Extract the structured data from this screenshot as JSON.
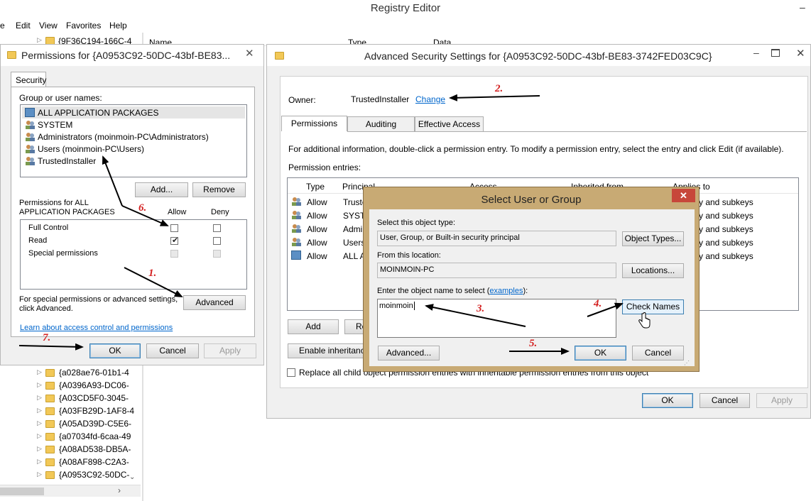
{
  "registry": {
    "title": "Registry Editor",
    "menu": [
      "e",
      "Edit",
      "View",
      "Favorites",
      "Help"
    ],
    "top_node": "{9F36C194-166C-4",
    "columns": [
      "Name",
      "Type",
      "Data"
    ],
    "tree_items": [
      "{a028ae76-01b1-4",
      "{A0396A93-DC06-",
      "{A03CD5F0-3045-",
      "{A03FB29D-1AF8-4",
      "{A05AD39D-C5E6-",
      "{a07034fd-6caa-49",
      "{A08AD538-DB5A-",
      "{A08AF898-C2A3-",
      "{A0953C92-50DC-"
    ]
  },
  "permissions": {
    "title": "Permissions for {A0953C92-50DC-43bf-BE83...",
    "tab": "Security",
    "group_label": "Group or user names:",
    "users": [
      "ALL APPLICATION PACKAGES",
      "SYSTEM",
      "Administrators (moinmoin-PC\\Administrators)",
      "Users (moinmoin-PC\\Users)",
      "TrustedInstaller"
    ],
    "add": "Add...",
    "remove": "Remove",
    "perm_label_1": "Permissions for ALL",
    "perm_label_2": "APPLICATION PACKAGES",
    "allow": "Allow",
    "deny": "Deny",
    "rows": [
      {
        "label": "Full Control",
        "allow": false
      },
      {
        "label": "Read",
        "allow": true
      },
      {
        "label": "Special permissions",
        "allow": false
      }
    ],
    "special_text_1": "For special permissions or advanced settings,",
    "special_text_2": "click Advanced.",
    "advanced": "Advanced",
    "learn_link": "Learn about access control and permissions",
    "ok": "OK",
    "cancel": "Cancel",
    "apply": "Apply"
  },
  "advanced": {
    "title": "Advanced Security Settings for {A0953C92-50DC-43bf-BE83-3742FED03C9C}",
    "owner_label": "Owner:",
    "owner": "TrustedInstaller",
    "change": "Change",
    "tabs": [
      "Permissions",
      "Auditing",
      "Effective Access"
    ],
    "info": "For additional information, double-click a permission entry. To modify a permission entry, select the entry and click Edit (if available).",
    "entries_label": "Permission entries:",
    "columns": [
      "Type",
      "Principal",
      "Access",
      "Inherited from",
      "Applies to"
    ],
    "rows": [
      {
        "type": "Allow",
        "principal": "Truste",
        "applies": "y and subkeys"
      },
      {
        "type": "Allow",
        "principal": "SYSTE",
        "applies": "y and subkeys"
      },
      {
        "type": "Allow",
        "principal": "Admi",
        "applies": "y and subkeys"
      },
      {
        "type": "Allow",
        "principal": "Users",
        "applies": "y and subkeys"
      },
      {
        "type": "Allow",
        "principal": "ALL A",
        "applies": "y and subkeys"
      }
    ],
    "add": "Add",
    "remove_partial": "Re",
    "enable_inheritance": "Enable inheritanc",
    "replace_text": "Replace all child object permission entries with inheritable permission entries from this object",
    "ok": "OK",
    "cancel": "Cancel",
    "apply": "Apply"
  },
  "select_user": {
    "title": "Select User or Group",
    "object_type_label": "Select this object type:",
    "object_type": "User, Group, or Built-in security principal",
    "object_types_btn": "Object Types...",
    "location_label": "From this location:",
    "location": "MOINMOIN-PC",
    "locations_btn": "Locations...",
    "enter_label": "Enter the object name to select (",
    "examples": "examples",
    "enter_label_end": "):",
    "input_value": "moinmoin",
    "check_names": "Check Names",
    "advanced": "Advanced...",
    "ok": "OK",
    "cancel": "Cancel"
  },
  "annotations": [
    "1.",
    "2.",
    "3.",
    "4.",
    "5.",
    "6.",
    "7."
  ],
  "colors": {
    "annotation": "#d42020",
    "dialog_frame": "#c8aa74",
    "close_red": "#c7473a",
    "link": "#0066cc"
  }
}
